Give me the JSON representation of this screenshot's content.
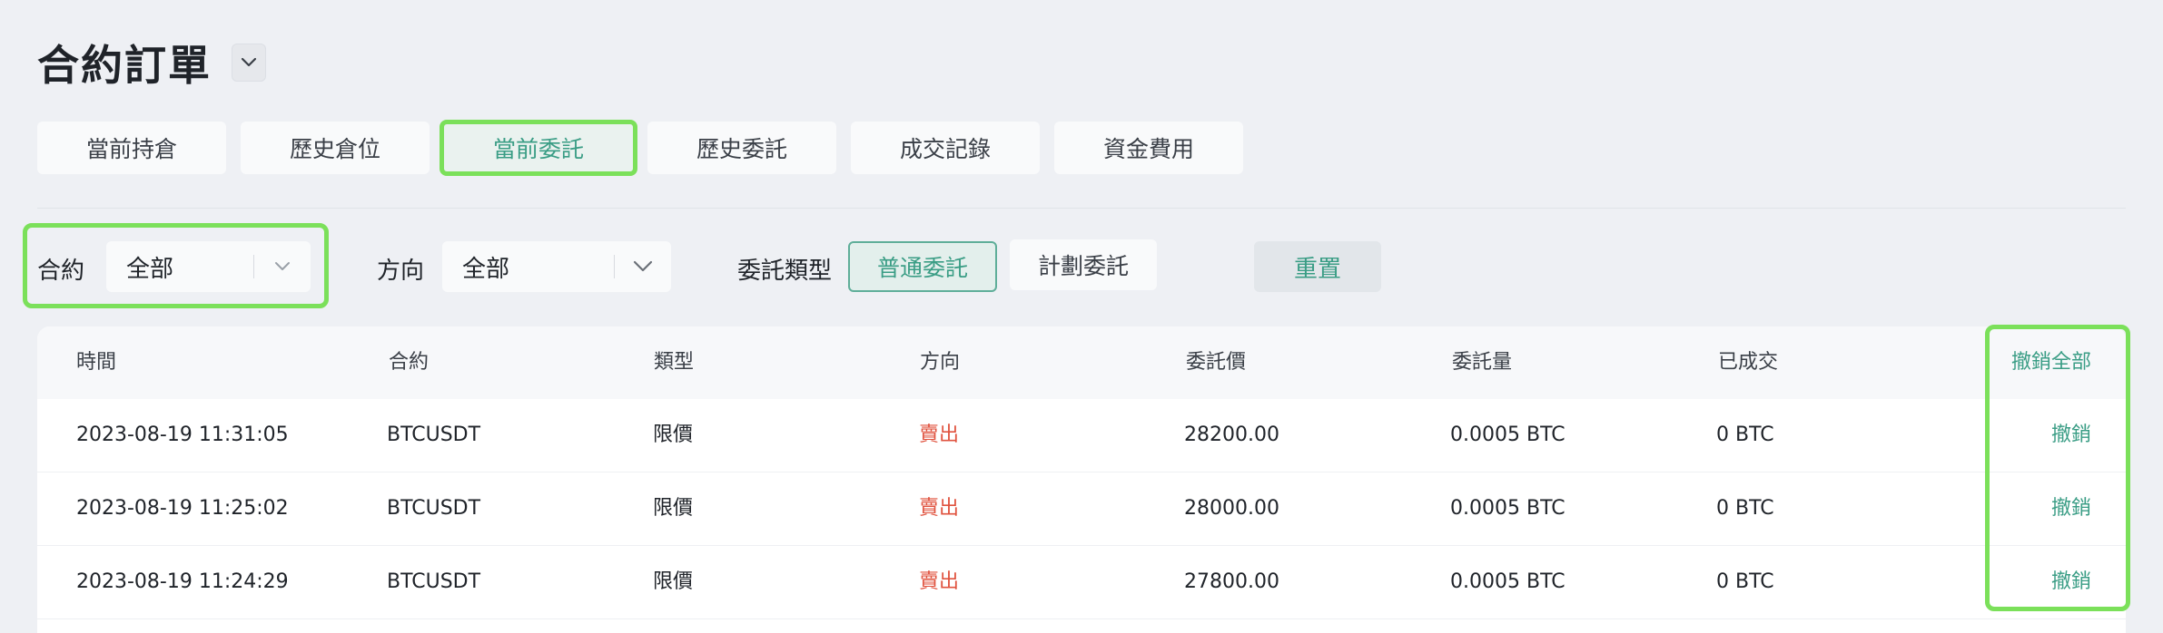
{
  "page": {
    "title": "合約訂單"
  },
  "tabs": [
    {
      "label": "當前持倉"
    },
    {
      "label": "歷史倉位"
    },
    {
      "label": "當前委託",
      "active": true
    },
    {
      "label": "歷史委託"
    },
    {
      "label": "成交記錄"
    },
    {
      "label": "資金費用"
    }
  ],
  "filters": {
    "contract_label": "合約",
    "contract_value": "全部",
    "direction_label": "方向",
    "direction_value": "全部",
    "order_type_label": "委託類型",
    "order_type_options": [
      "普通委託",
      "計劃委託"
    ],
    "order_type_selected": "普通委託",
    "reset_label": "重置"
  },
  "table": {
    "headers": [
      "時間",
      "合約",
      "類型",
      "方向",
      "委託價",
      "委託量",
      "已成交"
    ],
    "cancel_all_label": "撤銷全部",
    "cancel_label": "撤銷",
    "rows": [
      [
        "2023-08-19 11:31:05",
        "BTCUSDT",
        "限價",
        "賣出",
        "28200.00",
        "0.0005 BTC",
        "0 BTC"
      ],
      [
        "2023-08-19 11:25:02",
        "BTCUSDT",
        "限價",
        "賣出",
        "28000.00",
        "0.0005 BTC",
        "0 BTC"
      ],
      [
        "2023-08-19 11:24:29",
        "BTCUSDT",
        "限價",
        "賣出",
        "27800.00",
        "0.0005 BTC",
        "0 BTC"
      ]
    ]
  },
  "colors": {
    "accent": "#3a9d85",
    "sell": "#e0533f",
    "highlight": "#7be05a"
  },
  "icons": {
    "dropdown": "chevron-down-icon"
  }
}
